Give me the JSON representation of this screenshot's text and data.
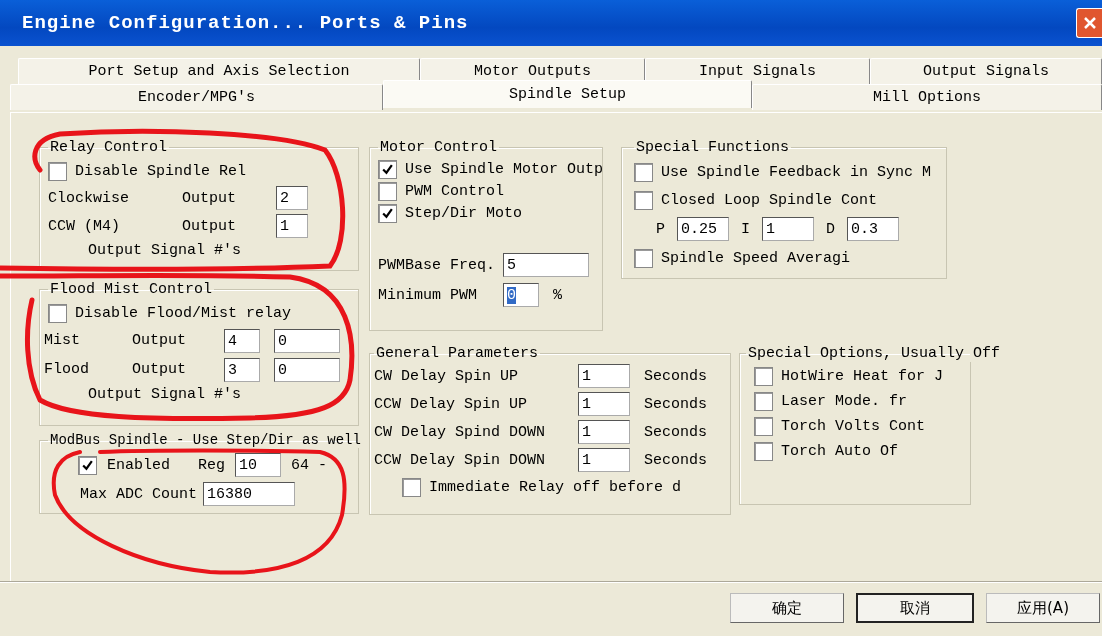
{
  "window": {
    "title": "Engine Configuration... Ports & Pins"
  },
  "tabs_back": [
    {
      "label": "Port Setup and Axis Selection",
      "selected": false
    },
    {
      "label": "Motor Outputs",
      "selected": false
    },
    {
      "label": "Input Signals",
      "selected": false
    },
    {
      "label": "Output Signals",
      "selected": false
    }
  ],
  "tabs_front": [
    {
      "label": "Encoder/MPG's",
      "selected": false
    },
    {
      "label": "Spindle Setup",
      "selected": true
    },
    {
      "label": "Mill Options",
      "selected": false
    }
  ],
  "relay_control": {
    "title": "Relay Control",
    "checkbox": {
      "label": "Disable Spindle Rel",
      "checked": false
    },
    "rows": [
      {
        "name": "Clockwise",
        "label": "Output",
        "value": "2"
      },
      {
        "name": "CCW (M4)",
        "label": "Output",
        "value": "1"
      }
    ],
    "footer": "Output Signal #'s"
  },
  "flood_mist_control": {
    "title": "Flood Mist Control",
    "checkbox": {
      "label": "Disable Flood/Mist relay",
      "checked": false
    },
    "rows": [
      {
        "name": "Mist",
        "label": "Output",
        "value": "4",
        "value_2": "0"
      },
      {
        "name": "Flood",
        "label": "Output",
        "value": "3",
        "value_2": "0"
      }
    ],
    "footer": "Output Signal #'s"
  },
  "modbus_spindle": {
    "title": "ModBus Spindle - Use Step/Dir as well",
    "enabled": {
      "label": "Enabled",
      "checked": true
    },
    "reg_label": "Reg",
    "reg_value": "10",
    "reg_suffix": "64 -",
    "max_adc_label": "Max ADC Count",
    "max_adc_value": "16380"
  },
  "motor_control": {
    "title": "Motor Control",
    "checkboxes": [
      {
        "label": "Use Spindle Motor Outp",
        "checked": true
      },
      {
        "label": "PWM Control",
        "checked": false
      },
      {
        "label": "Step/Dir Moto",
        "checked": true
      }
    ],
    "pwm_base_label": "PWMBase Freq.",
    "pwm_base_value": "5",
    "min_pwm_label": "Minimum PWM",
    "min_pwm_value": "0",
    "min_pwm_text_selected": true,
    "min_pwm_unit": "%"
  },
  "special_functions": {
    "title": "Special Functions",
    "items": [
      {
        "kind": "checkbox",
        "label": "Use Spindle Feedback in Sync M",
        "checked": false
      },
      {
        "kind": "checkbox",
        "label": "Closed Loop Spindle Cont",
        "checked": false
      },
      {
        "kind": "pid",
        "fields": [
          {
            "label": "P",
            "value": "0.25"
          },
          {
            "label": "I",
            "value": "1"
          },
          {
            "label": "D",
            "value": "0.3"
          }
        ]
      },
      {
        "kind": "checkbox",
        "label": "Spindle Speed Averagi",
        "checked": false
      }
    ]
  },
  "general_parameters": {
    "title": "General Parameters",
    "rows": [
      {
        "label": "CW Delay Spin UP",
        "value": "1",
        "unit": "Seconds"
      },
      {
        "label": "CCW Delay Spin UP",
        "value": "1",
        "unit": "Seconds"
      },
      {
        "label": "CW Delay Spind DOWN",
        "value": "1",
        "unit": "Seconds"
      },
      {
        "label": "CCW Delay Spin DOWN",
        "value": "1",
        "unit": "Seconds"
      }
    ],
    "checkbox": {
      "label": "Immediate Relay off before d",
      "checked": false
    }
  },
  "special_options": {
    "title": "Special Options, Usually Off",
    "checkboxes": [
      {
        "label": "HotWire Heat for J",
        "checked": false
      },
      {
        "label": "Laser Mode. fr",
        "checked": false
      },
      {
        "label": "Torch Volts Cont",
        "checked": false
      },
      {
        "label": "Torch Auto Of",
        "checked": false
      }
    ]
  },
  "buttons": [
    {
      "label": "确定",
      "default": false
    },
    {
      "label": "取消",
      "default": true
    },
    {
      "label": "应用(A)",
      "default": false
    }
  ]
}
